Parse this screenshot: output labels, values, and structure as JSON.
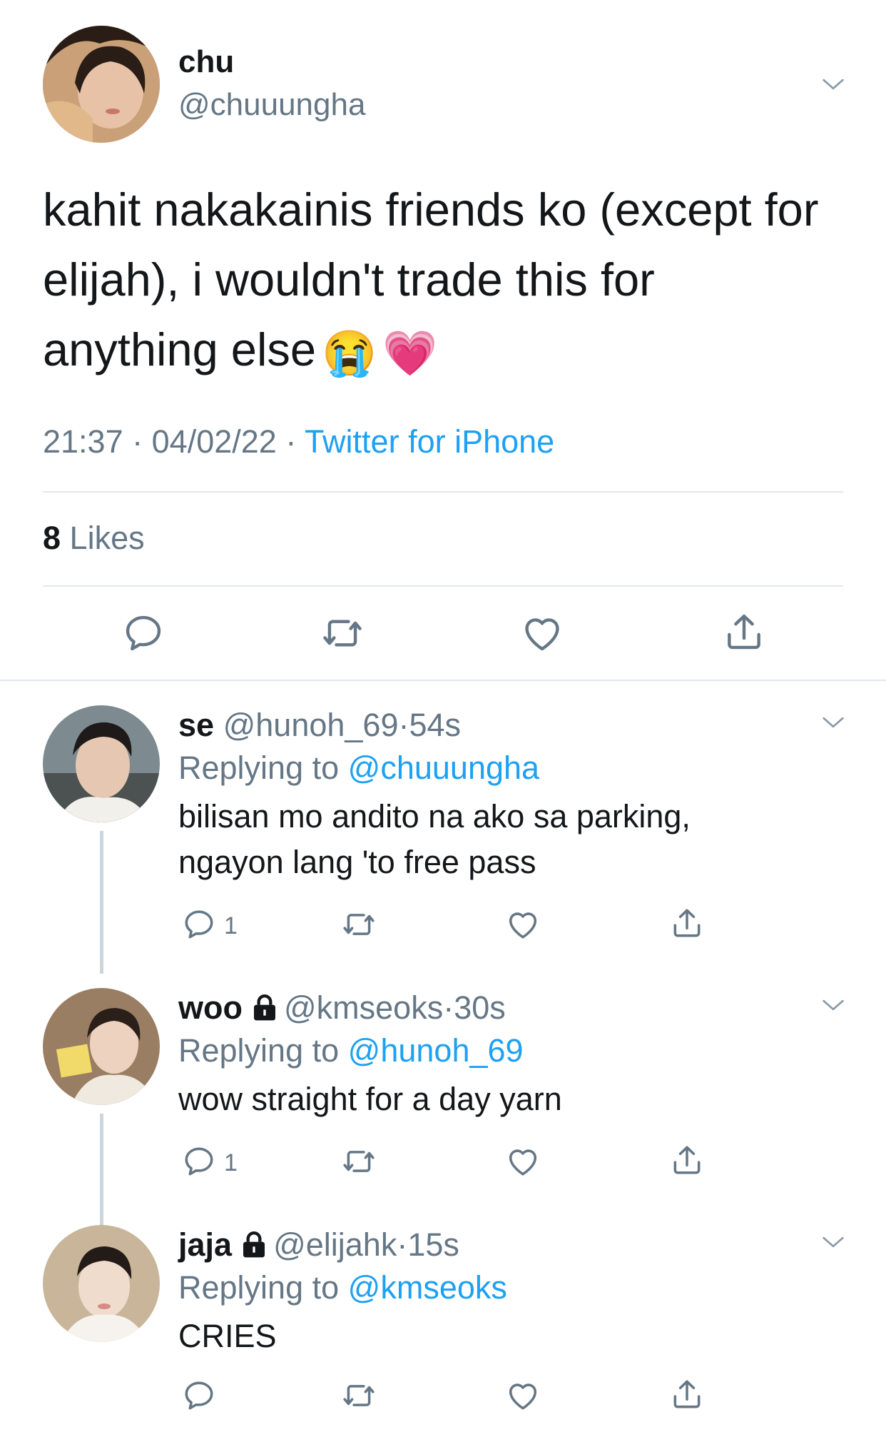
{
  "main_tweet": {
    "display_name": "chu",
    "handle": "@chuuungha",
    "text_line1": "kahit nakakainis friends ko (except for",
    "text_line2": "elijah), i wouldn't trade this for",
    "text_line3": "anything else",
    "emoji_1": "😭",
    "emoji_2": "💗",
    "time": "21:37",
    "date": "04/02/22",
    "separator": "·",
    "source": "Twitter for iPhone",
    "likes_count": "8",
    "likes_label": "Likes"
  },
  "replies": [
    {
      "display_name": "se",
      "handle": "@hunoh_69",
      "age": "54s",
      "replying_prefix": "Replying to",
      "replying_to": "@chuuungha",
      "text_line1": "bilisan mo andito na ako sa parking,",
      "text_line2": "ngayon lang 'to free pass",
      "reply_count": "1"
    },
    {
      "display_name": "woo",
      "handle": "@kmseoks",
      "age": "30s",
      "replying_prefix": "Replying to",
      "replying_to": "@hunoh_69",
      "text_line1": "wow straight for a day yarn",
      "reply_count": "1"
    },
    {
      "display_name": "jaja",
      "handle": "@elijahk",
      "age": "15s",
      "replying_prefix": "Replying to",
      "replying_to": "@kmseoks",
      "text_line1": "CRIES"
    }
  ],
  "colors": {
    "link_blue": "#1da1f2",
    "secondary_gray": "#657786",
    "divider": "#e1e8ed"
  },
  "icons": [
    "chevron-down-icon",
    "reply-icon",
    "retweet-icon",
    "like-icon",
    "share-icon",
    "lock-icon"
  ]
}
